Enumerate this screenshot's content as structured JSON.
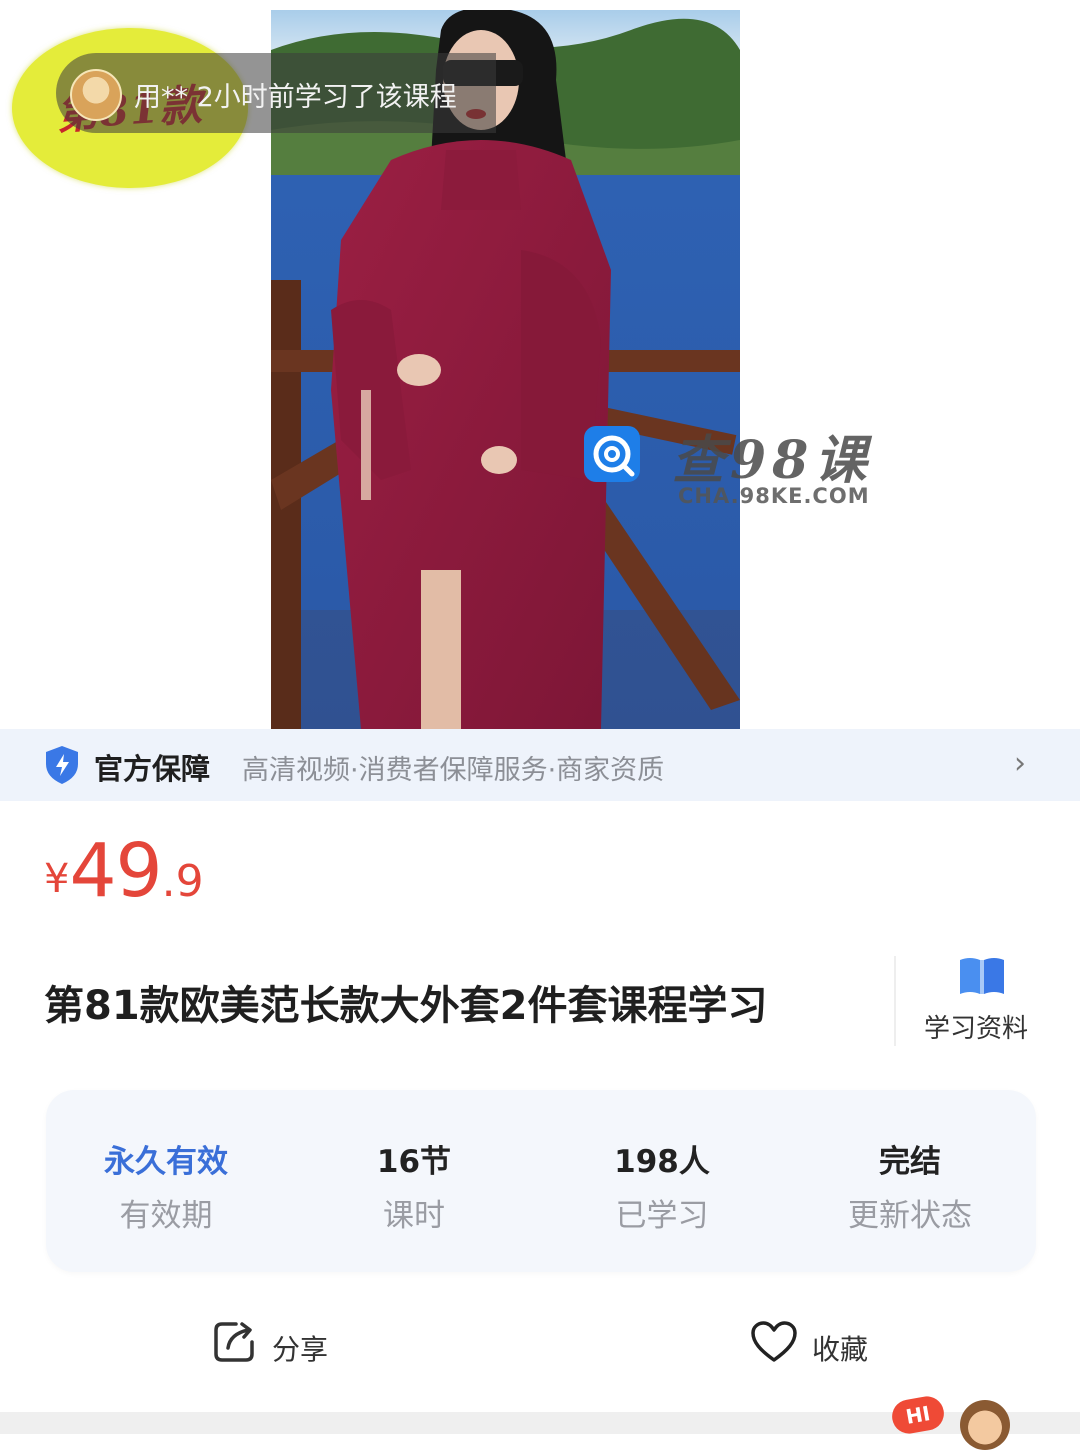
{
  "sticker": {
    "text": "第81款"
  },
  "toast": {
    "text": "用** 2小时前学习了该课程"
  },
  "watermark": {
    "title": "查98课",
    "url": "CHA.98KE.COM"
  },
  "guarantee": {
    "title": "官方保障",
    "items": "高清视频·消费者保障服务·商家资质",
    "chevron": "›"
  },
  "price": {
    "currency": "¥",
    "integer": "49",
    "decimal": ".9",
    "color": "#e4463a"
  },
  "course": {
    "title": "第81款欧美范长款大外套2件套课程学习"
  },
  "material": {
    "label": "学习资料",
    "icon": "book-icon"
  },
  "stats": [
    {
      "value": "永久有效",
      "label": "有效期"
    },
    {
      "value": "16节",
      "label": "课时"
    },
    {
      "value": "198人",
      "label": "已学习"
    },
    {
      "value": "完结",
      "label": "更新状态"
    }
  ],
  "actions": {
    "share": "分享",
    "favorite": "收藏"
  },
  "mascot": {
    "bubble": "HI"
  },
  "colors": {
    "accent_blue": "#3a6fd8",
    "guarantee_bg": "#eef3fb",
    "sticker_yellow": "#e4ec3a"
  }
}
